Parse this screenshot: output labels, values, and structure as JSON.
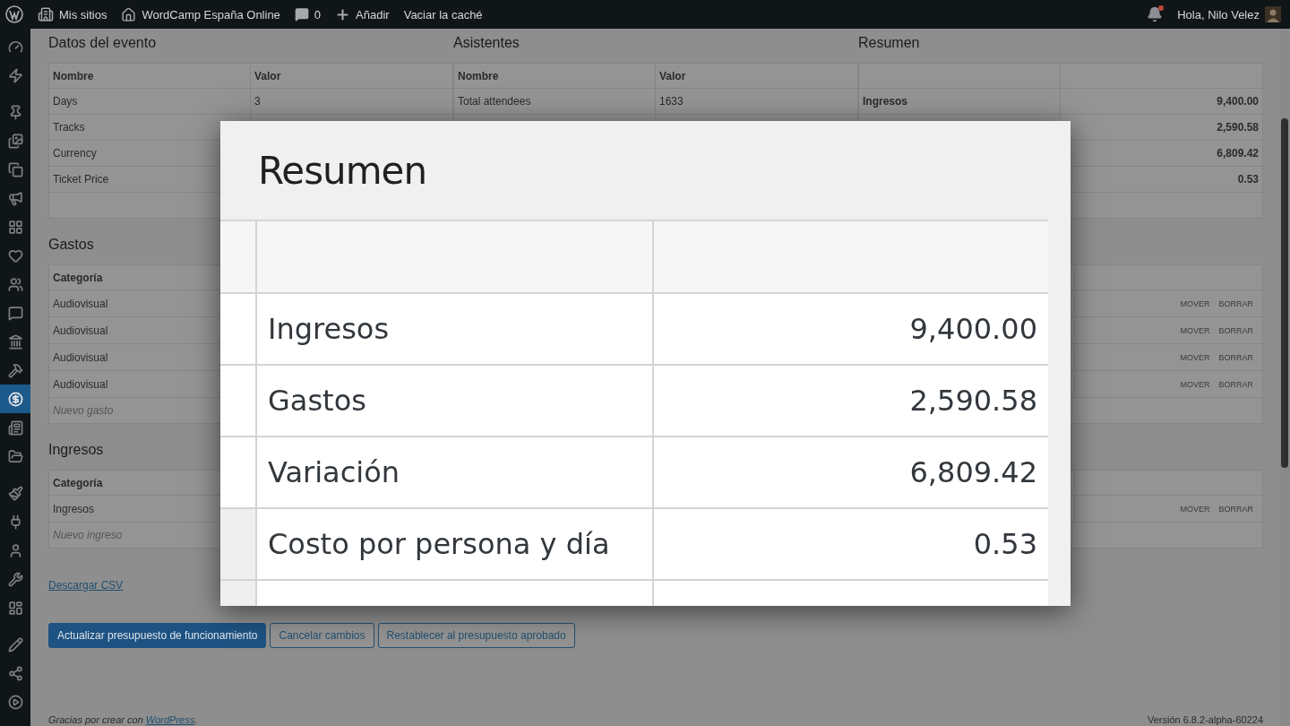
{
  "admin_bar": {
    "items": [
      {
        "kind": "logo"
      },
      {
        "kind": "sites",
        "label": "Mis sitios"
      },
      {
        "kind": "home",
        "label": "WordCamp España Online"
      },
      {
        "kind": "comments",
        "label": "0"
      },
      {
        "kind": "new",
        "label": "Añadir"
      },
      {
        "kind": "text",
        "label": "Vaciar la caché"
      }
    ],
    "notifications": {
      "unread": true
    },
    "greeting": "Hola, Nilo Velez"
  },
  "sidebar": {
    "groups": [
      {
        "items": [
          {
            "selected": false
          },
          {
            "selected": false
          }
        ]
      },
      {
        "items": [
          {
            "selected": false
          },
          {
            "selected": false
          },
          {
            "selected": false
          },
          {
            "selected": false
          },
          {
            "selected": false
          },
          {
            "selected": false
          },
          {
            "selected": false
          },
          {
            "selected": false
          },
          {
            "selected": false
          },
          {
            "selected": false
          },
          {
            "selected": true
          },
          {
            "selected": false
          },
          {
            "selected": false
          }
        ]
      },
      {
        "items": [
          {
            "selected": false
          },
          {
            "selected": false
          },
          {
            "selected": false
          },
          {
            "selected": false
          },
          {
            "selected": false
          }
        ]
      },
      {
        "items": [
          {
            "selected": false
          },
          {
            "selected": false
          },
          {
            "selected": false
          }
        ]
      }
    ]
  },
  "event_data": {
    "title": "Datos del evento",
    "columns": [
      "Nombre",
      "Valor"
    ],
    "rows": [
      {
        "name": "Days",
        "value": "3"
      },
      {
        "name": "Tracks"
      },
      {
        "name": "Currency"
      },
      {
        "name": "Ticket Price"
      }
    ]
  },
  "attendees": {
    "title": "Asistentes",
    "columns": [
      "Nombre",
      "Valor"
    ],
    "rows": [
      {
        "name": "Total attendees",
        "value": "1633"
      }
    ]
  },
  "summary": {
    "title": "Resumen",
    "rows": [
      {
        "name": "Ingresos",
        "value": "9,400.00"
      },
      {
        "value": "2,590.58"
      },
      {
        "value": "6,809.42"
      },
      {
        "value": "0.53"
      }
    ]
  },
  "expenses": {
    "title": "Gastos",
    "columns": [
      "Categoría"
    ],
    "rows": [
      {
        "category": "Audiovisual",
        "actions": [
          "MOVER",
          "BORRAR"
        ]
      },
      {
        "category": "Audiovisual",
        "actions": [
          "MOVER",
          "BORRAR"
        ]
      },
      {
        "category": "Audiovisual",
        "actions": [
          "MOVER",
          "BORRAR"
        ]
      },
      {
        "category": "Audiovisual",
        "actions": [
          "MOVER",
          "BORRAR"
        ]
      }
    ],
    "new_placeholder": "Nuevo gasto"
  },
  "income": {
    "title": "Ingresos",
    "columns": [
      "Categoría"
    ],
    "rows": [
      {
        "category": "Ingresos",
        "actions": [
          "MOVER",
          "BORRAR"
        ]
      }
    ],
    "new_placeholder": "Nuevo ingreso"
  },
  "download_link": "Descargar CSV",
  "buttons": [
    {
      "label": "Actualizar presupuesto de funcionamiento",
      "primary": true
    },
    {
      "label": "Cancelar cambios",
      "primary": false
    },
    {
      "label": "Restablecer al presupuesto aprobado",
      "primary": false
    }
  ],
  "footer": {
    "thanks": "Gracias por crear con ",
    "link": "WordPress",
    "end": ".",
    "version": "Versión 6.8.2-alpha-60224"
  },
  "zoom_popup": {
    "title": "Resumen",
    "rows": [
      {
        "label": "Ingresos",
        "value": "9,400.00"
      },
      {
        "label": "Gastos",
        "value": "2,590.58"
      },
      {
        "label": "Variación",
        "value": "6,809.42"
      },
      {
        "label": "Costo por persona y día",
        "value": "0.53"
      }
    ]
  }
}
